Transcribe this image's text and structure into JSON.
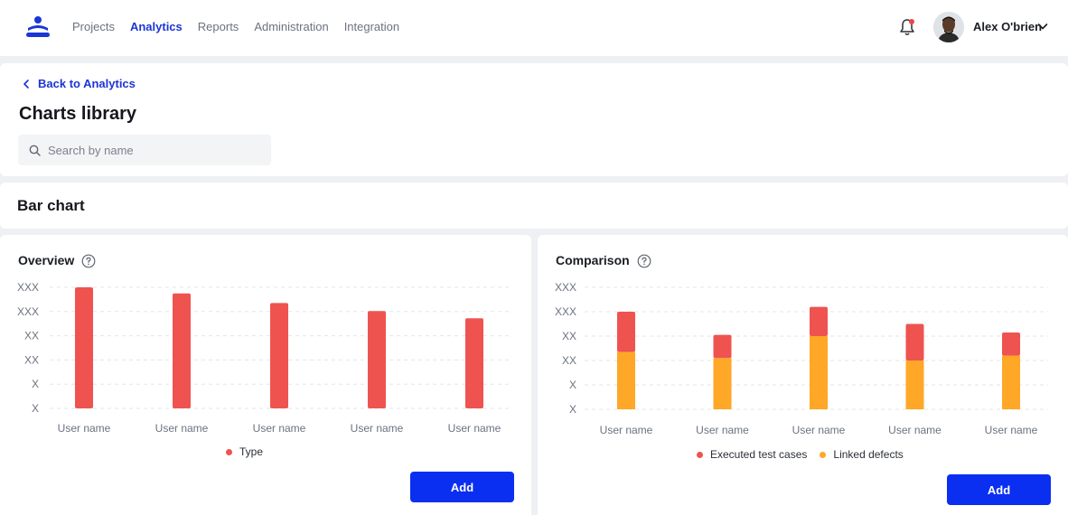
{
  "nav": {
    "links": [
      {
        "label": "Projects",
        "active": false
      },
      {
        "label": "Analytics",
        "active": true
      },
      {
        "label": "Reports",
        "active": false
      },
      {
        "label": "Administration",
        "active": false
      },
      {
        "label": "Integration",
        "active": false
      }
    ],
    "user_name": "Alex O'brien",
    "notification_color": "#ef4444",
    "accent": "#1b35d6"
  },
  "header": {
    "back_label": "Back to Analytics",
    "title": "Charts library",
    "search_placeholder": "Search by name"
  },
  "section": {
    "title": "Bar chart"
  },
  "cards": [
    {
      "title": "Overview",
      "add_label": "Add",
      "legend": [
        {
          "label": "Type",
          "color": "#ef5350"
        }
      ]
    },
    {
      "title": "Comparison",
      "add_label": "Add",
      "legend": [
        {
          "label": "Executed test cases",
          "color": "#ef5350"
        },
        {
          "label": "Linked defects",
          "color": "#ffa726"
        }
      ]
    }
  ],
  "chart_data": [
    {
      "type": "bar",
      "categories": [
        "User name",
        "User name",
        "User name",
        "User name",
        "User name"
      ],
      "y_tick_labels": [
        "X",
        "X",
        "XX",
        "XX",
        "XXX",
        "XXX"
      ],
      "ylim": [
        0,
        5
      ],
      "series": [
        {
          "name": "Type",
          "color": "#ef5350",
          "values": [
            5.0,
            4.75,
            4.35,
            4.02,
            3.72
          ]
        }
      ],
      "grid": true,
      "legend_position": "bottom"
    },
    {
      "type": "bar",
      "stacked": true,
      "categories": [
        "User name",
        "User name",
        "User name",
        "User name",
        "User name"
      ],
      "y_tick_labels": [
        "X",
        "X",
        "XX",
        "XX",
        "XXX",
        "XXX"
      ],
      "ylim": [
        0,
        5
      ],
      "series": [
        {
          "name": "Linked defects",
          "color": "#ffa726",
          "values": [
            2.35,
            2.1,
            3.0,
            2.0,
            2.2
          ]
        },
        {
          "name": "Executed test cases",
          "color": "#ef5350",
          "values": [
            1.65,
            0.95,
            1.2,
            1.5,
            0.95
          ]
        }
      ],
      "grid": true,
      "legend_position": "bottom"
    }
  ]
}
